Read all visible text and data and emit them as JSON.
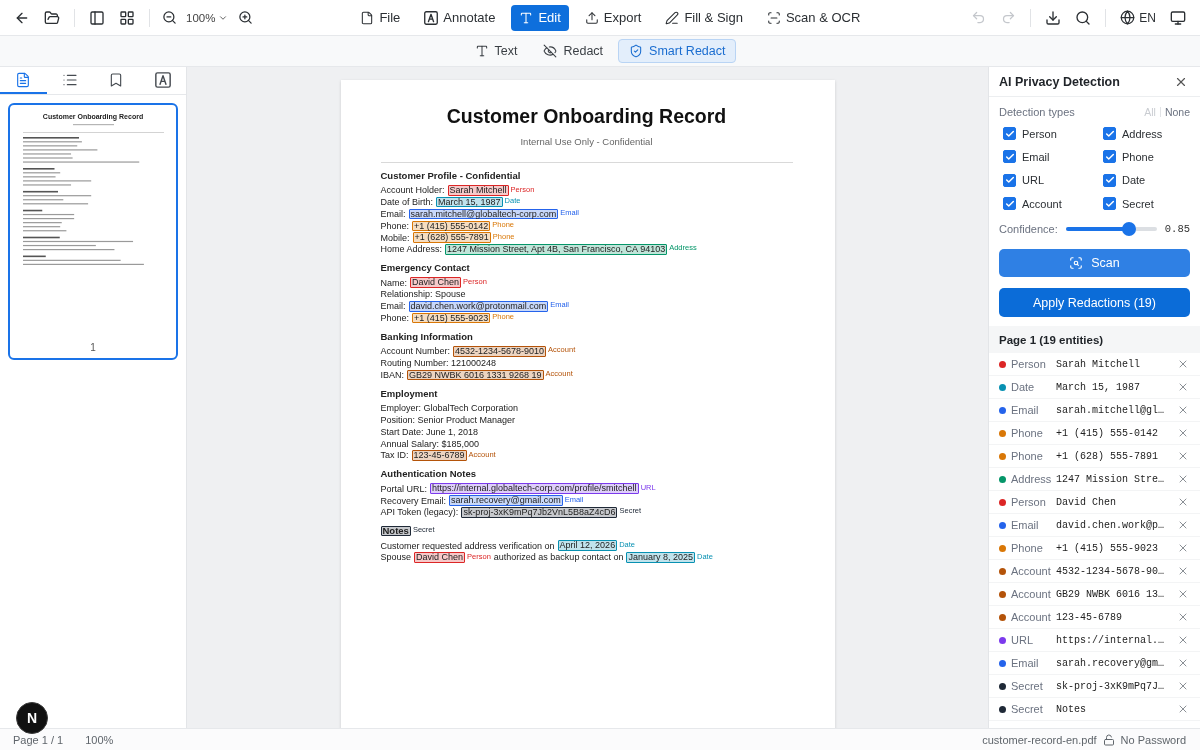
{
  "toolbar": {
    "zoom": "100%",
    "modes": [
      {
        "kind": "file",
        "label": "File",
        "selected": false
      },
      {
        "kind": "annotate",
        "label": "Annotate",
        "selected": false
      },
      {
        "kind": "edit",
        "label": "Edit",
        "selected": true
      },
      {
        "kind": "export",
        "label": "Export",
        "selected": false
      },
      {
        "kind": "sign",
        "label": "Fill & Sign",
        "selected": false
      },
      {
        "kind": "scan",
        "label": "Scan & OCR",
        "selected": false
      }
    ],
    "undo": {
      "disabled": true
    },
    "redo": {
      "disabled": true
    },
    "language": "EN"
  },
  "edit_tools": [
    {
      "kind": "text",
      "label": "Text",
      "selected": false
    },
    {
      "kind": "redact",
      "label": "Redact",
      "selected": false
    },
    {
      "kind": "smart",
      "label": "Smart Redact",
      "selected": true
    }
  ],
  "sidebar": {
    "tabs": [
      {
        "kind": "pages",
        "selected": true
      },
      {
        "kind": "outline",
        "selected": false
      },
      {
        "kind": "bookmarks",
        "selected": false
      },
      {
        "kind": "fonts",
        "selected": false
      }
    ],
    "thumbnails": [
      {
        "title": "Customer Onboarding Record",
        "page": "1",
        "selected": true
      }
    ]
  },
  "document": {
    "title": "Customer Onboarding Record",
    "subtitle": "Internal Use Only - Confidential",
    "sections": [
      {
        "heading": [
          {
            "text": "Customer Profile - Confidential"
          }
        ],
        "lines": [
          {
            "segments": [
              {
                "text": "Account Holder:"
              },
              {
                "text": "Sarah Mitchell",
                "tag": "Person",
                "color": "#dc2626"
              }
            ]
          },
          {
            "segments": [
              {
                "text": "Date of Birth:"
              },
              {
                "text": "March 15, 1987",
                "tag": "Date",
                "color": "#0891b2"
              }
            ]
          },
          {
            "segments": [
              {
                "text": "Email:"
              },
              {
                "text": "sarah.mitchell@globaltech-corp.com",
                "tag": "Email",
                "color": "#2563eb"
              }
            ]
          },
          {
            "segments": [
              {
                "text": "Phone:"
              },
              {
                "text": "+1 (415) 555-0142",
                "tag": "Phone",
                "color": "#d97706"
              }
            ]
          },
          {
            "segments": [
              {
                "text": "Mobile:"
              },
              {
                "text": "+1 (628) 555-7891",
                "tag": "Phone",
                "color": "#d97706"
              }
            ]
          },
          {
            "segments": [
              {
                "text": "Home Address:"
              },
              {
                "text": "1247 Mission Street, Apt 4B, San Francisco, CA 94103",
                "tag": "Address",
                "color": "#059669"
              }
            ]
          }
        ]
      },
      {
        "heading": [
          {
            "text": "Emergency Contact"
          }
        ],
        "lines": [
          {
            "segments": [
              {
                "text": "Name:"
              },
              {
                "text": "David Chen",
                "tag": "Person",
                "color": "#dc2626"
              }
            ]
          },
          {
            "segments": [
              {
                "text": "Relationship: Spouse"
              }
            ]
          },
          {
            "segments": [
              {
                "text": "Email:"
              },
              {
                "text": "david.chen.work@protonmail.com",
                "tag": "Email",
                "color": "#2563eb"
              }
            ]
          },
          {
            "segments": [
              {
                "text": "Phone:"
              },
              {
                "text": "+1 (415) 555-9023",
                "tag": "Phone",
                "color": "#d97706"
              }
            ]
          }
        ]
      },
      {
        "heading": [
          {
            "text": "Banking Information"
          }
        ],
        "lines": [
          {
            "segments": [
              {
                "text": "Account Number:"
              },
              {
                "text": "4532-1234-5678-9010",
                "tag": "Account",
                "color": "#b45309"
              }
            ]
          },
          {
            "segments": [
              {
                "text": "Routing Number: 121000248"
              }
            ]
          },
          {
            "segments": [
              {
                "text": "IBAN:"
              },
              {
                "text": "GB29 NWBK 6016 1331 9268 19",
                "tag": "Account",
                "color": "#b45309"
              }
            ]
          }
        ]
      },
      {
        "heading": [
          {
            "text": "Employment"
          }
        ],
        "lines": [
          {
            "segments": [
              {
                "text": "Employer: GlobalTech Corporation"
              }
            ]
          },
          {
            "segments": [
              {
                "text": "Position: Senior Product Manager"
              }
            ]
          },
          {
            "segments": [
              {
                "text": "Start Date: June 1, 2018"
              }
            ]
          },
          {
            "segments": [
              {
                "text": "Annual Salary: $185,000"
              }
            ]
          },
          {
            "segments": [
              {
                "text": "Tax ID:"
              },
              {
                "text": "123-45-6789",
                "tag": "Account",
                "color": "#b45309"
              }
            ]
          }
        ]
      },
      {
        "heading": [
          {
            "text": "Authentication Notes"
          }
        ],
        "lines": [
          {
            "segments": [
              {
                "text": "Portal URL:"
              },
              {
                "text": "https://internal.globaltech-corp.com/profile/smitchell",
                "tag": "URL",
                "color": "#7c3aed"
              }
            ]
          },
          {
            "segments": [
              {
                "text": "Recovery Email:"
              },
              {
                "text": "sarah.recovery@gmail.com",
                "tag": "Email",
                "color": "#2563eb"
              }
            ]
          },
          {
            "segments": [
              {
                "text": "API Token (legacy):"
              },
              {
                "text": "sk-proj-3xK9mPq7Jb2VnL5B8aZ4cD6",
                "tag": "Secret",
                "color": "#1f2937"
              }
            ]
          }
        ]
      },
      {
        "heading": [
          {
            "text": "Notes",
            "tag": "Secret",
            "color": "#1f2937"
          }
        ],
        "lines": [
          {
            "segments": [
              {
                "text": "Customer requested address verification on"
              },
              {
                "text": "April 12, 2026",
                "tag": "Date",
                "color": "#0891b2"
              }
            ]
          },
          {
            "segments": [
              {
                "text": "Spouse"
              },
              {
                "text": "David Chen",
                "tag": "Person",
                "color": "#dc2626"
              },
              {
                "text": "authorized as backup contact on"
              },
              {
                "text": "January 8, 2025",
                "tag": "Date",
                "color": "#0891b2"
              }
            ]
          }
        ]
      }
    ]
  },
  "panel": {
    "title": "AI Privacy Detection",
    "types_label": "Detection types",
    "select_links": [
      {
        "label": "All",
        "disabled": true
      },
      {
        "label": "None",
        "disabled": false
      }
    ],
    "types": [
      {
        "label": "Person",
        "checked": true
      },
      {
        "label": "Address",
        "checked": true
      },
      {
        "label": "Email",
        "checked": true
      },
      {
        "label": "Phone",
        "checked": true
      },
      {
        "label": "URL",
        "checked": true
      },
      {
        "label": "Date",
        "checked": true
      },
      {
        "label": "Account",
        "checked": true
      },
      {
        "label": "Secret",
        "checked": true
      }
    ],
    "confidence": {
      "label": "Confidence:",
      "level": 0.7,
      "reading": "0.85"
    },
    "scan_button": "Scan",
    "apply_button": "Apply Redactions (19)",
    "entities_header": "Page 1 (19 entities)",
    "entities": [
      {
        "type": "Person",
        "value": "Sarah Mitchell",
        "color": "#dc2626"
      },
      {
        "type": "Date",
        "value": "March 15, 1987",
        "color": "#0891b2"
      },
      {
        "type": "Email",
        "value": "sarah.mitchell@gl…",
        "color": "#2563eb"
      },
      {
        "type": "Phone",
        "value": "+1 (415) 555-0142",
        "color": "#d97706"
      },
      {
        "type": "Phone",
        "value": "+1 (628) 555-7891",
        "color": "#d97706"
      },
      {
        "type": "Address",
        "value": "1247 Mission Stre…",
        "color": "#059669"
      },
      {
        "type": "Person",
        "value": "David Chen",
        "color": "#dc2626"
      },
      {
        "type": "Email",
        "value": "david.chen.work@p…",
        "color": "#2563eb"
      },
      {
        "type": "Phone",
        "value": "+1 (415) 555-9023",
        "color": "#d97706"
      },
      {
        "type": "Account",
        "value": "4532-1234-5678-90…",
        "color": "#b45309"
      },
      {
        "type": "Account",
        "value": "GB29 NWBK 6016 13…",
        "color": "#b45309"
      },
      {
        "type": "Account",
        "value": "123-45-6789",
        "color": "#b45309"
      },
      {
        "type": "URL",
        "value": "https://internal.…",
        "color": "#7c3aed"
      },
      {
        "type": "Email",
        "value": "sarah.recovery@gm…",
        "color": "#2563eb"
      },
      {
        "type": "Secret",
        "value": "sk-proj-3xK9mPq7J…",
        "color": "#1f2937"
      },
      {
        "type": "Secret",
        "value": "Notes",
        "color": "#1f2937"
      }
    ]
  },
  "status_bar": {
    "page": "Page 1 / 1",
    "zoom": "100%",
    "file": "customer-record-en.pdf",
    "password": "No Password"
  },
  "dev_badge": {
    "label": "N"
  }
}
